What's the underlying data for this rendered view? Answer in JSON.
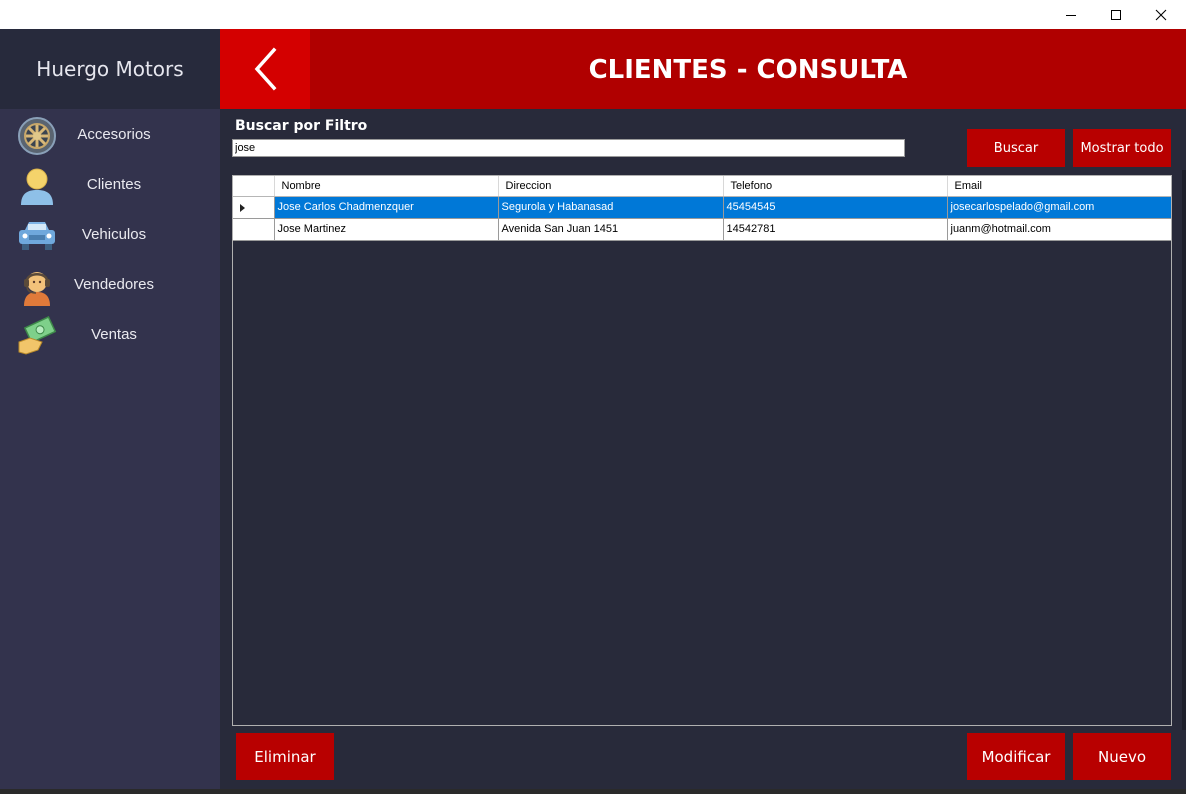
{
  "window": {
    "controls": [
      "minimize",
      "maximize",
      "close"
    ]
  },
  "sidebar": {
    "brand": "Huergo Motors",
    "items": [
      {
        "label": "Accesorios",
        "icon": "wheel-icon"
      },
      {
        "label": "Clientes",
        "icon": "user-icon"
      },
      {
        "label": "Vehiculos",
        "icon": "car-icon"
      },
      {
        "label": "Vendedores",
        "icon": "headset-agent-icon"
      },
      {
        "label": "Ventas",
        "icon": "money-hand-icon"
      }
    ]
  },
  "header": {
    "title": "CLIENTES - CONSULTA",
    "back_icon": "chevron-left-icon"
  },
  "filter": {
    "label": "Buscar por Filtro",
    "value": "jose"
  },
  "buttons": {
    "buscar": "Buscar",
    "mostrar_todo": "Mostrar todo",
    "eliminar": "Eliminar",
    "modificar": "Modificar",
    "nuevo": "Nuevo"
  },
  "table": {
    "columns": [
      "Nombre",
      "Direccion",
      "Telefono",
      "Email"
    ],
    "rows": [
      [
        "Jose Carlos Chadmenzquer",
        "Segurola y Habanasad",
        "45454545",
        "josecarlospelado@gmail.com"
      ],
      [
        "Jose Martinez",
        "Avenida San Juan 1451",
        "14542781",
        "juanm@hotmail.com"
      ]
    ],
    "selected_row": 0
  },
  "colors": {
    "accent": "#b00000",
    "back_button": "#d40000",
    "sidebar": "#33334d",
    "brand_bg": "#272a3c",
    "content_bg": "#282a3a",
    "selection": "#0078d7"
  }
}
